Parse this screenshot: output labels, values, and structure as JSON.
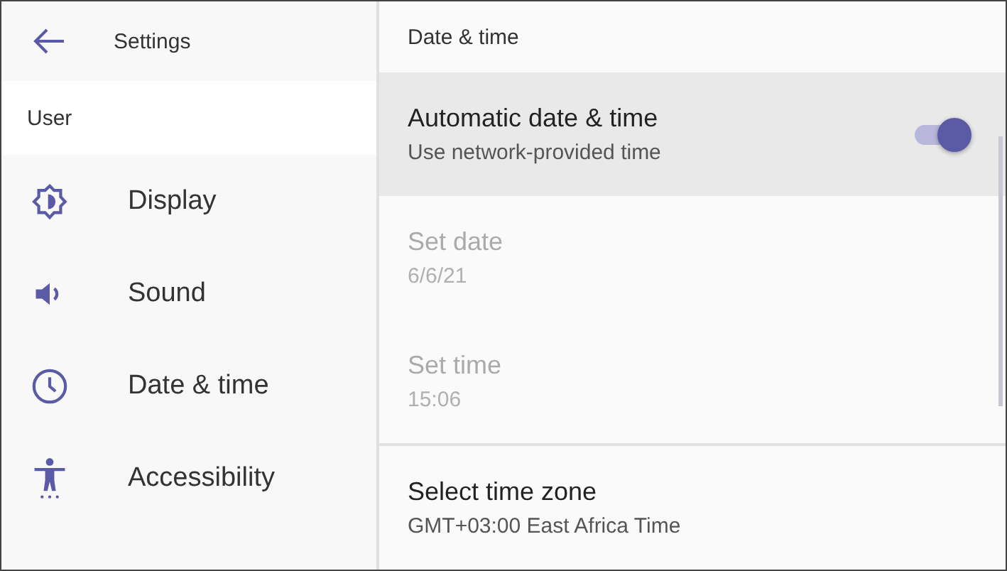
{
  "sidebar": {
    "title": "Settings",
    "section": "User",
    "items": [
      {
        "label": "Display",
        "selected": false
      },
      {
        "label": "Sound",
        "selected": false
      },
      {
        "label": "Date & time",
        "selected": false
      },
      {
        "label": "Accessibility",
        "selected": false
      }
    ]
  },
  "panel": {
    "title": "Date & time",
    "groups": [
      [
        {
          "title": "Automatic date & time",
          "subtitle": "Use network-provided time",
          "highlighted": true,
          "disabled": false,
          "switch": {
            "on": true
          }
        },
        {
          "title": "Set date",
          "subtitle": "6/6/21",
          "highlighted": false,
          "disabled": true
        },
        {
          "title": "Set time",
          "subtitle": "15:06",
          "highlighted": false,
          "disabled": true
        }
      ],
      [
        {
          "title": "Select time zone",
          "subtitle": "GMT+03:00 East Africa Time",
          "highlighted": false,
          "disabled": false
        }
      ]
    ]
  }
}
